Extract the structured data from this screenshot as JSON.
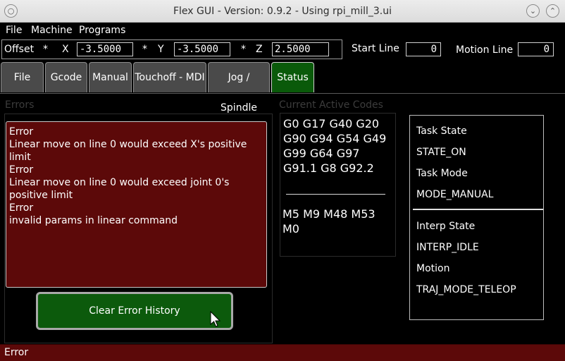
{
  "window": {
    "title": "Flex GUI - Version: 0.9.2 - Using rpi_mill_3.ui",
    "close_glyph": "○",
    "minimize_glyph": "⌄",
    "maximize_glyph": "⌃"
  },
  "menu": {
    "items": [
      "File",
      "Machine",
      "Programs"
    ]
  },
  "offsets": {
    "label": "Offset",
    "x_marker": "*",
    "x_label": "X",
    "x_value": "-3.5000",
    "y_marker": "*",
    "y_label": "Y",
    "y_value": "-3.5000",
    "z_marker": "*",
    "z_label": "Z",
    "z_value": "2.5000"
  },
  "lines": {
    "start_label": "Start Line",
    "start_value": "0",
    "motion_label": "Motion Line",
    "motion_value": "0"
  },
  "tabs": {
    "items": [
      "File",
      "Gcode",
      "Manual",
      "Touchoff - MDI",
      "Jog / Spindle",
      "Status"
    ],
    "active": "Status"
  },
  "errors": {
    "title": "Errors",
    "lines": [
      "Error",
      "Linear move on line 0 would exceed X's positive limit",
      "Error",
      "Linear move on line 0 would exceed joint 0's positive limit",
      "Error",
      "invalid params in linear command"
    ],
    "clear_button": "Clear Error History"
  },
  "active_codes": {
    "title": "Current Active Codes",
    "g_codes": "G0 G17 G40 G20 G90 G94 G54 G49 G99 G64 G97 G91.1 G8 G92.2",
    "m_codes": "M5 M9 M48 M53 M0"
  },
  "status": {
    "task_state_label": "Task State",
    "task_state_value": "STATE_ON",
    "task_mode_label": "Task Mode",
    "task_mode_value": "MODE_MANUAL",
    "interp_state_label": "Interp State",
    "interp_state_value": "INTERP_IDLE",
    "motion_label": "Motion",
    "motion_value": "TRAJ_MODE_TELEOP"
  },
  "statusbar": {
    "text": "Error"
  },
  "colors": {
    "error_red": "#5c0909",
    "active_green": "#0a5a0a",
    "tab_gray": "#4a4a4a"
  }
}
